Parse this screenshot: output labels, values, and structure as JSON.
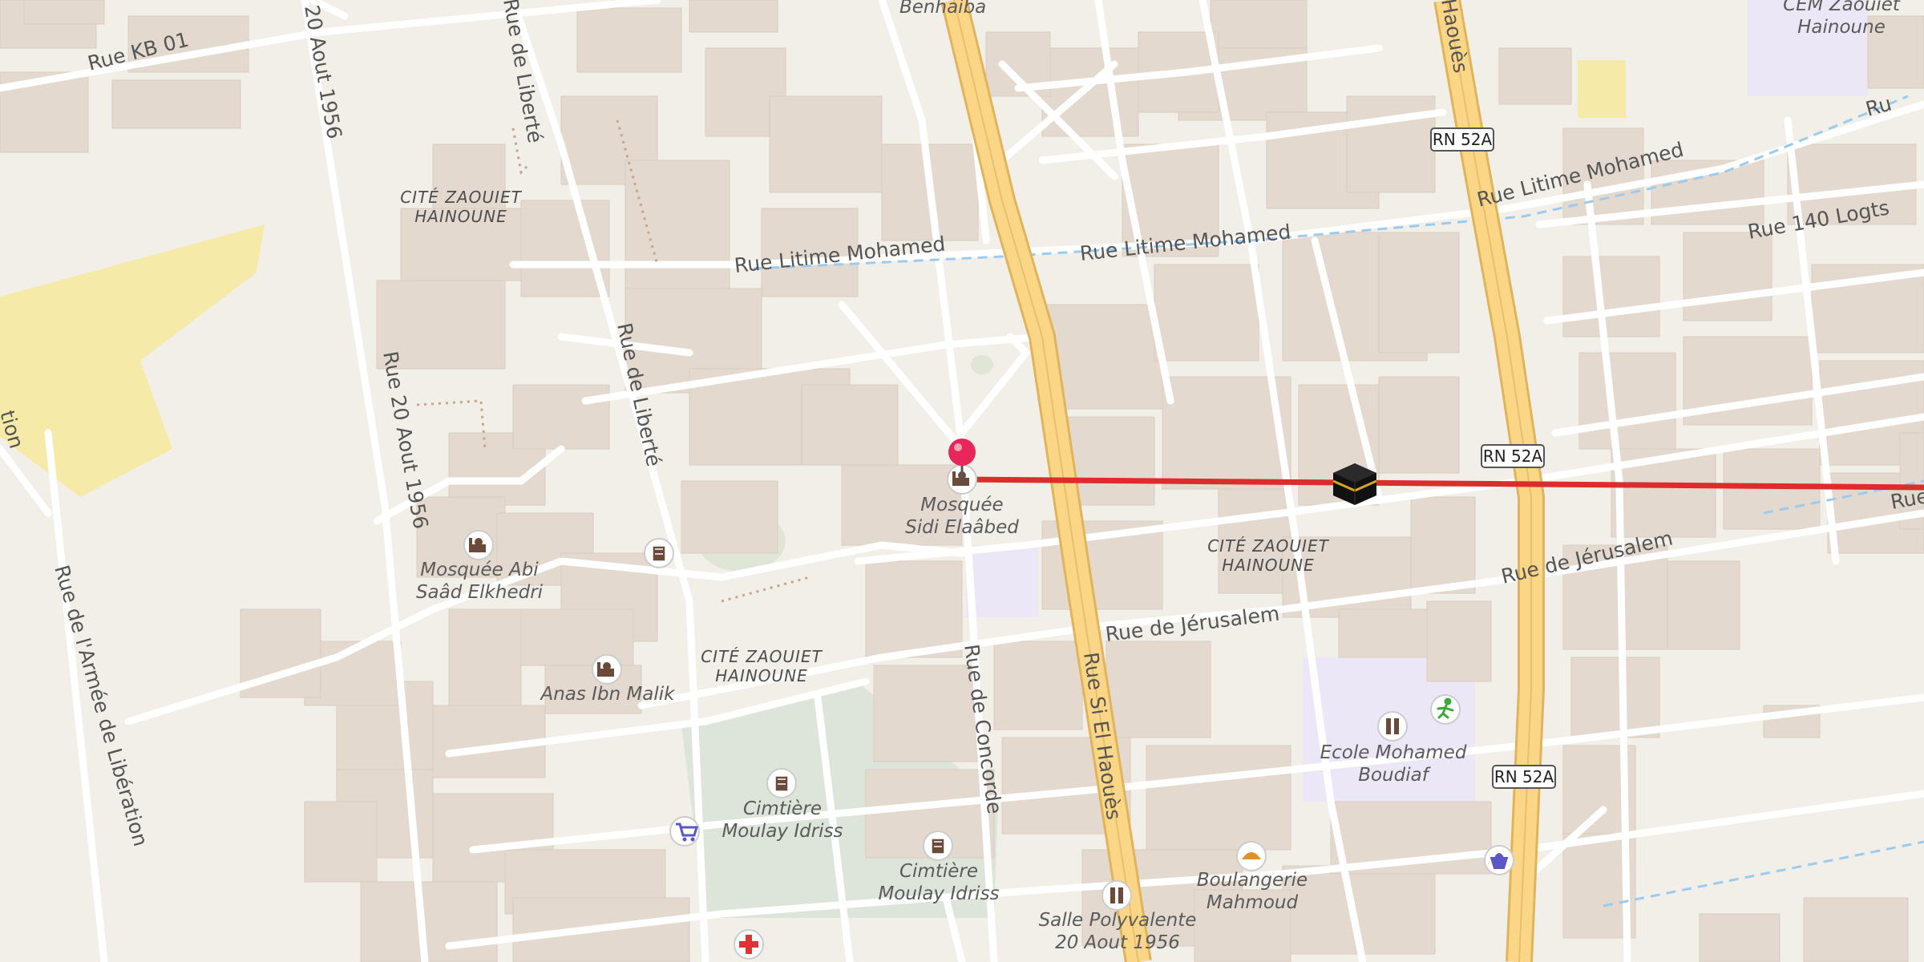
{
  "map": {
    "route_color": "#dc2c2c",
    "marker_color": "#e8265c",
    "road_colors": {
      "primary_fill": "#fcd687",
      "primary_casing": "#e0b45c",
      "minor": "#ffffff",
      "building": "#e3d9ce",
      "park": "#dde4da",
      "school": "#ece7f6",
      "sand": "#f6eaa8"
    }
  },
  "streets": [
    {
      "id": "kb01",
      "text": "Rue KB 01"
    },
    {
      "id": "aout1956_top",
      "text": "20 Aout 1956"
    },
    {
      "id": "aout1956_mid",
      "text": "Rue 20 Aout 1956"
    },
    {
      "id": "liberte_top",
      "text": "Rue de Liberté"
    },
    {
      "id": "liberte_mid",
      "text": "Rue de Liberté"
    },
    {
      "id": "armee",
      "text": "Rue de l'Armée de Libération"
    },
    {
      "id": "armee_edge",
      "text": "tion"
    },
    {
      "id": "litime1",
      "text": "Rue Litime Mohamed"
    },
    {
      "id": "litime2",
      "text": "Rue Litime Mohamed"
    },
    {
      "id": "litime3",
      "text": "Rue Litime Mohamed"
    },
    {
      "id": "logts",
      "text": "Rue 140 Logts"
    },
    {
      "id": "jerusalem1",
      "text": "Rue de Jérusalem"
    },
    {
      "id": "jerusalem2",
      "text": "Rue de Jérusalem"
    },
    {
      "id": "concorde",
      "text": "Rue de Concorde"
    },
    {
      "id": "sielhaoues",
      "text": "Rue Si El Haouès"
    },
    {
      "id": "haoues_top",
      "text": "Haouès"
    },
    {
      "id": "benhaiba",
      "text": "Benhaiba"
    },
    {
      "id": "ru_edge",
      "text": "Ru"
    },
    {
      "id": "rue_edge",
      "text": "Rue"
    }
  ],
  "shields": [
    {
      "id": "rn1",
      "text": "RN 52A"
    },
    {
      "id": "rn2",
      "text": "RN 52A"
    },
    {
      "id": "rn3",
      "text": "RN 52A"
    }
  ],
  "areas": [
    {
      "id": "cite1",
      "line1": "CITÉ ZAOUIET",
      "line2": "HAINOUNE"
    },
    {
      "id": "cite2",
      "line1": "CITÉ ZAOUIET",
      "line2": "HAINOUNE"
    },
    {
      "id": "cite3",
      "line1": "CITÉ ZAOUIET",
      "line2": "HAINOUNE"
    }
  ],
  "pois": [
    {
      "id": "sidi",
      "icon": "mosque-icon",
      "line1": "Mosquée",
      "line2": "Sidi Elaâbed"
    },
    {
      "id": "abi",
      "icon": "mosque-icon",
      "line1": "Mosquée Abi",
      "line2": "Saâd Elkhedri"
    },
    {
      "id": "anas",
      "icon": "mosque-icon",
      "line1": "Anas Ibn Malik",
      "line2": ""
    },
    {
      "id": "cim1",
      "icon": "cemetery-icon",
      "line1": "Cimtière",
      "line2": "Moulay Idriss"
    },
    {
      "id": "cim2",
      "icon": "cemetery-icon",
      "line1": "Cimtière",
      "line2": "Moulay Idriss"
    },
    {
      "id": "ecole",
      "icon": "school-icon",
      "line1": "Ecole Mohamed",
      "line2": "Boudiaf"
    },
    {
      "id": "boul",
      "icon": "bakery-icon",
      "line1": "Boulangerie",
      "line2": "Mahmoud"
    },
    {
      "id": "salle",
      "icon": "sports-hall-icon",
      "line1": "Salle Polyvalente",
      "line2": "20 Aout 1956"
    },
    {
      "id": "cem",
      "icon": "school-icon",
      "line1": "CEM Zaouiet",
      "line2": "Hainoune"
    }
  ]
}
